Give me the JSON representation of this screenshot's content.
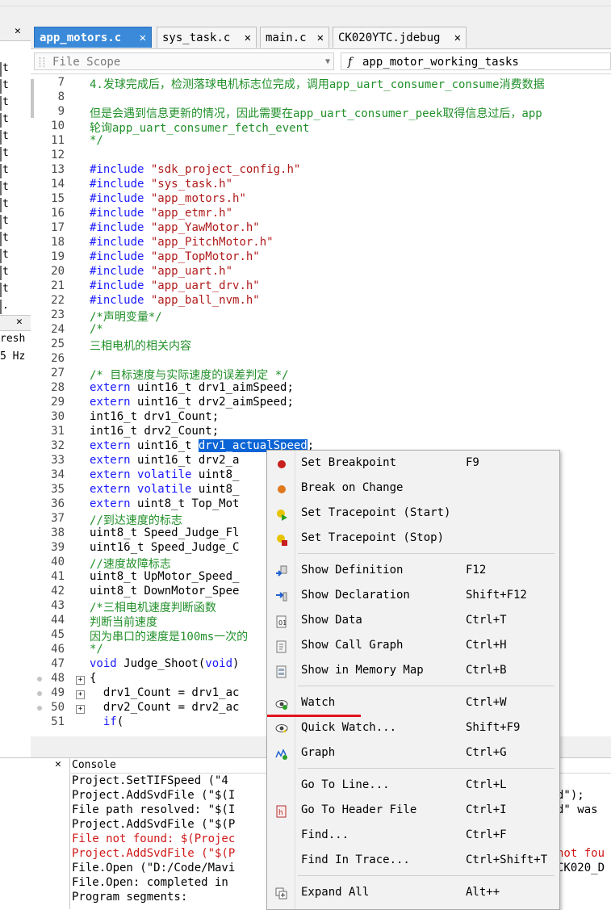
{
  "tabs": [
    {
      "label": "app_motors.c",
      "active": true
    },
    {
      "label": "sys_task.c",
      "active": false
    },
    {
      "label": "main.c",
      "active": false
    },
    {
      "label": "CK020YTC.jdebug",
      "active": false
    }
  ],
  "tab_close_glyph": "✕",
  "scope": {
    "left": "File Scope",
    "right_icon": "f",
    "right": "app_motor_working_tasks"
  },
  "left_panel": {
    "items": [
      "t",
      "t",
      "t",
      "t",
      "t",
      "t",
      "t",
      "t",
      "t",
      "t",
      "t",
      "t",
      "t",
      "t",
      "."
    ],
    "frag1": "resh",
    "frag2": "5 Hz"
  },
  "line_numbers": [
    "7",
    "8",
    "9",
    "10",
    "11",
    "12",
    "13",
    "14",
    "15",
    "16",
    "17",
    "18",
    "19",
    "20",
    "21",
    "22",
    "23",
    "24",
    "25",
    "26",
    "27",
    "28",
    "29",
    "30",
    "31",
    "32",
    "33",
    "34",
    "35",
    "36",
    "37",
    "38",
    "39",
    "40",
    "41",
    "42",
    "43",
    "44",
    "45",
    "46",
    "47",
    "48",
    "49",
    "50",
    "51"
  ],
  "code": {
    "l7": "4.发球完成后，检测落球电机标志位完成，调用app_uart_consumer_consume消费数据",
    "l9": "但是会遇到信息更新的情况，因此需要在app_uart_consumer_peek取得信息过后，app",
    "l10": "轮询app_uart_consumer_fetch_event",
    "l11": "*/",
    "include_kw": "#include",
    "includes": [
      "\"sdk_project_config.h\"",
      "\"sys_task.h\"",
      "\"app_motors.h\"",
      "\"app_etmr.h\"",
      "\"app_YawMotor.h\"",
      "\"app_PitchMotor.h\"",
      "\"app_TopMotor.h\"",
      "\"app_uart.h\"",
      "\"app_uart_drv.h\"",
      "\"app_ball_nvm.h\""
    ],
    "l23": "/*声明变量*/",
    "l24": "/*",
    "l25": "三相电机的相关内容",
    "l27": "/* 目标速度与实际速度的误差判定 */",
    "extern": "extern",
    "volatile": "volatile",
    "l28": " uint16_t drv1_aimSpeed;",
    "l29": " uint16_t drv2_aimSpeed;",
    "l30": "int16_t drv1_Count;",
    "l31": "int16_t drv2_Count;",
    "l32a": " uint16_t ",
    "l32sel": "drv1_actualSpeed",
    "l32b": ";",
    "l33": " uint16_t drv2_a",
    "l34": " uint8_",
    "l35": " uint8_",
    "l36": " uint8_t Top_Mot",
    "l37": "//到达速度的标志",
    "l38": "uint8_t Speed_Judge_Fl",
    "l39": "uint16_t Speed_Judge_C",
    "l40": "//速度故障标志",
    "l41": "uint8_t UpMotor_Speed_",
    "l42": "uint8_t DownMotor_Spee",
    "l43": "/*三相电机速度判断函数",
    "l44": "判断当前速度",
    "l45": "因为串口的速度是100ms一次的",
    "l46": "*/",
    "void": "void",
    "l47": " Judge_Shoot(",
    "l47b": ")",
    "l48": "{",
    "l49": "  drv1_Count = drv1_ac",
    "l50": "  drv2_Count = drv2_ac",
    "if": "if",
    "l51b": "("
  },
  "menu": {
    "items": [
      {
        "label": "Set Breakpoint",
        "shortcut": "F9",
        "icon": "breakpoint-red-icon"
      },
      {
        "label": "Break on Change",
        "shortcut": "",
        "icon": "breakpoint-orange-icon"
      },
      {
        "label": "Set Tracepoint (Start)",
        "shortcut": "",
        "icon": "tracepoint-start-icon"
      },
      {
        "label": "Set Tracepoint (Stop)",
        "shortcut": "",
        "icon": "tracepoint-stop-icon"
      },
      {
        "label": "Show Definition",
        "shortcut": "F12",
        "icon": "definition-icon"
      },
      {
        "label": "Show Declaration",
        "shortcut": "Shift+F12",
        "icon": "declaration-icon"
      },
      {
        "label": "Show Data",
        "shortcut": "Ctrl+T",
        "icon": "data-icon"
      },
      {
        "label": "Show Call Graph",
        "shortcut": "Ctrl+H",
        "icon": "call-graph-icon"
      },
      {
        "label": "Show in Memory Map",
        "shortcut": "Ctrl+B",
        "icon": "memory-map-icon"
      },
      {
        "label": "Watch",
        "shortcut": "Ctrl+W",
        "icon": "watch-eye-icon"
      },
      {
        "label": "Quick Watch...",
        "shortcut": "Shift+F9",
        "icon": "quick-watch-icon"
      },
      {
        "label": "Graph",
        "shortcut": "Ctrl+G",
        "icon": "graph-icon"
      },
      {
        "label": "Go To Line...",
        "shortcut": "Ctrl+L",
        "icon": ""
      },
      {
        "label": "Go To Header File",
        "shortcut": "Ctrl+I",
        "icon": "header-file-icon"
      },
      {
        "label": "Find...",
        "shortcut": "Ctrl+F",
        "icon": ""
      },
      {
        "label": "Find In Trace...",
        "shortcut": "Ctrl+Shift+T",
        "icon": ""
      },
      {
        "label": "Expand All",
        "shortcut": "Alt++",
        "icon": "expand-all-icon"
      }
    ]
  },
  "console": {
    "title": "Console",
    "lines": [
      {
        "text": "Project.SetTIFSpeed (\"4",
        "error": false
      },
      {
        "text": "Project.AddSvdFile (\"$(I",
        "error": false
      },
      {
        "text": "File path resolved: \"$(I",
        "error": false
      },
      {
        "text": "Project.AddSvdFile (\"$(P",
        "error": false
      },
      {
        "text": "File not found: $(Projec",
        "error": true
      },
      {
        "text": "Project.AddSvdFile (\"$(P",
        "error": true
      },
      {
        "text": "File.Open (\"D:/Code/Mavi",
        "error": false
      },
      {
        "text": "File.Open: completed in",
        "error": false
      },
      {
        "text": "Program segments:",
        "error": false
      }
    ],
    "right_frags": [
      {
        "text": "d\");",
        "error": false
      },
      {
        "text": "d\" was",
        "error": false
      },
      {
        "text": "not fou",
        "error": true
      },
      {
        "text": "CK020_D",
        "error": false
      }
    ]
  },
  "colors": {
    "accent": "#3b8ad9",
    "selection": "#0a64d6",
    "comment": "#22902a",
    "keyword": "#1a1aff",
    "string": "#b01a1a",
    "error": "#d01818",
    "annotation": "#e0141e"
  }
}
